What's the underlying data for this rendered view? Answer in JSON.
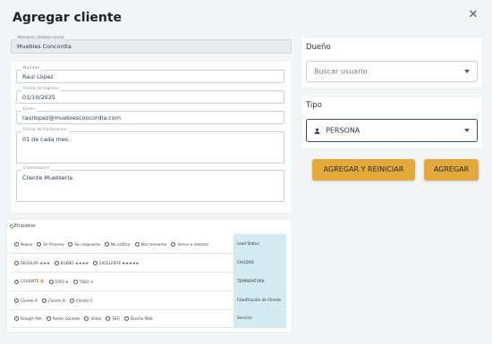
{
  "dialog": {
    "title": "Agregar cliente"
  },
  "form": {
    "razon_social": {
      "label": "Nombre / Razón social",
      "value": "Muebles Concordia"
    },
    "nombre": {
      "label": "Nombre",
      "value": "Raul López"
    },
    "fecha_ingreso": {
      "label": "Fecha de Ingreso",
      "value": "01/10/2025"
    },
    "email": {
      "label": "Email",
      "value": "raullopez@mueblesconcordia.com"
    },
    "fecha_facturacion": {
      "label": "Fecha de Facturacion",
      "value": "01 de cada mes"
    },
    "comentarios": {
      "label": "Comentarios",
      "value": "Cliente Muebleria"
    }
  },
  "owner": {
    "label": "Dueño",
    "placeholder": "Buscar usuario"
  },
  "type": {
    "label": "Tipo",
    "value": "PERSONA"
  },
  "buttons": {
    "add_reset": "AGREGAR Y REINICIAR",
    "add": "AGREGAR"
  },
  "colors": {
    "accent": "#e3a93a",
    "category_bg": "#d4eaf1",
    "selected_border": "#3b4a66"
  },
  "tags": {
    "title": "Etiquetas",
    "rows": [
      {
        "category": "Lead Status",
        "options": [
          "Nuevo",
          "En Proceso",
          "Sin respuesta",
          "No califica",
          "Mal momento",
          "Volver a intentar"
        ]
      },
      {
        "category": "CALIDAD",
        "options": [
          "REGULAR ★★★",
          "BUENO ★★★★",
          "EXCELENTE ★★★★★"
        ]
      },
      {
        "category": "TEMPERATURA",
        "options": [
          "CALIENTE 🔥",
          "FRÍO ❄",
          "TIBIO ☀"
        ]
      },
      {
        "category": "Clasificación de Cliente",
        "options": [
          "Cliente A",
          "Cliente B",
          "Cliente C"
        ]
      },
      {
        "category": "Servicio",
        "options": [
          "Google Ads",
          "Redes sociales",
          "Video",
          "SEO",
          "Diseño Web"
        ]
      }
    ]
  }
}
